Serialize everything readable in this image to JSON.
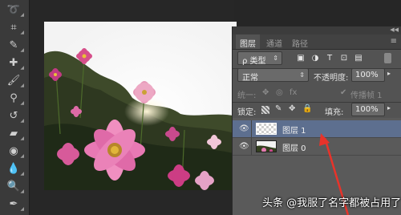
{
  "layers_panel": {
    "tabs": [
      "图层",
      "通道",
      "路径"
    ],
    "filter_kind": "ρ 类型",
    "blend_mode": "正常",
    "opacity_label": "不透明度:",
    "opacity_value": "100%",
    "unify_label": "统一:",
    "propagate_label": "传播帧 1",
    "lock_label": "锁定:",
    "fill_label": "填充:",
    "fill_value": "100%",
    "layers": [
      {
        "name": "图层 1",
        "selected": true
      },
      {
        "name": "图层 0",
        "selected": false
      }
    ]
  },
  "watermark": "头条 @我服了名字都被占用了",
  "colors": {
    "accent_arrow": "#e8332a",
    "selected_layer": "#5d6f8f"
  }
}
